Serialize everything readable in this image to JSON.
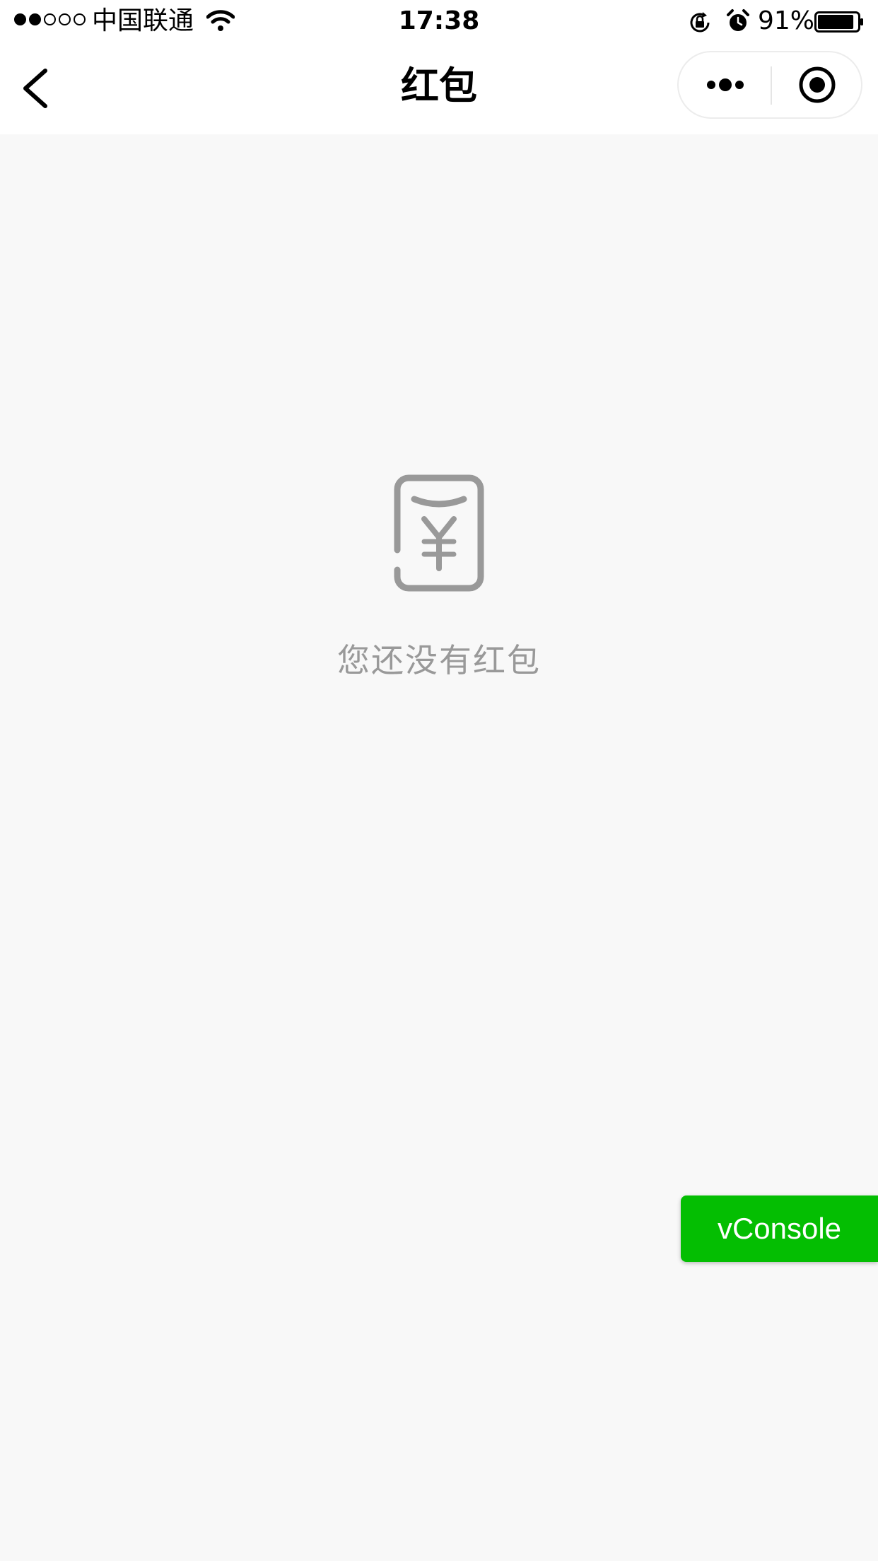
{
  "status_bar": {
    "signal_strength": "2 of 5",
    "carrier": "中国联通",
    "time": "17:38",
    "battery_percent": "91%",
    "battery_level": 0.91
  },
  "nav": {
    "back_icon": "chevron-left-icon",
    "title": "红包",
    "more_icon": "more-dots-icon",
    "close_icon": "target-close-icon"
  },
  "empty_state": {
    "icon": "red-envelope-yuan-icon",
    "message": "您还没有红包"
  },
  "vconsole": {
    "label": "vConsole",
    "color": "#04be02"
  },
  "colors": {
    "background": "#f8f8f8",
    "muted_text": "#999999"
  }
}
